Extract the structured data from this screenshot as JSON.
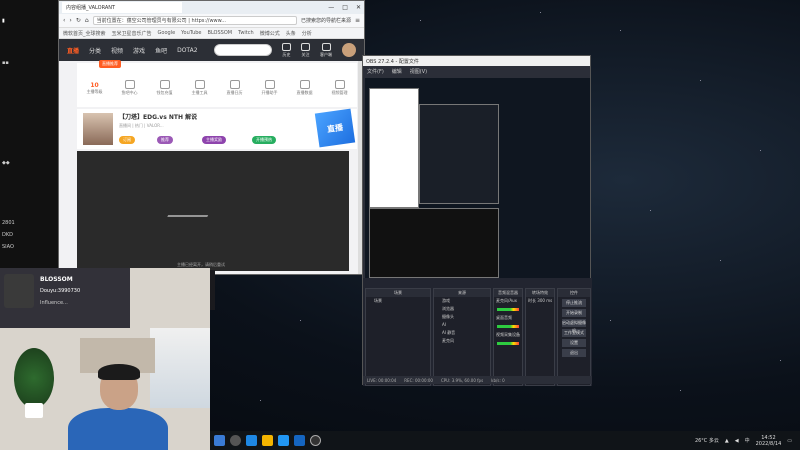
{
  "browser": {
    "tab_title": "内容组播_VALORANT",
    "address": "当前位置在：蕴空公司管理员与有限公司 | https://www...",
    "page_title_right": "已搜索您的导航栏来源",
    "bookmarks": [
      "微软首页_全球搜索",
      "玉米卫星音乐广告",
      "Google",
      "YouTube",
      "BLOSSOM",
      "Twitch",
      "微博公式",
      "头条",
      "分析"
    ],
    "nav_items": [
      "直播",
      "分类",
      "视频",
      "游戏",
      "鱼吧",
      "DOTA2"
    ],
    "header_icons": [
      "历史",
      "关注",
      "客户端"
    ]
  },
  "site_menu": {
    "live_badge": "直播推荐",
    "items": [
      {
        "num": "10",
        "label": "主播等级"
      },
      {
        "num": "",
        "label": "鱼吧中心"
      },
      {
        "num": "",
        "label": "钱包充值"
      },
      {
        "num": "",
        "label": "主播工具"
      },
      {
        "num": "",
        "label": "直播日历"
      },
      {
        "num": "",
        "label": "开播助手"
      },
      {
        "num": "",
        "label": "直播数据"
      },
      {
        "num": "",
        "label": "视频管理"
      }
    ]
  },
  "room": {
    "title": "【刀塔】EDG.vs NTH 解说",
    "subtitle": "直播间 | 热门 | VALOR...",
    "tags": [
      "订阅",
      "推荐",
      "主播奖励",
      "开播预热"
    ],
    "promo": "直播"
  },
  "video": {
    "caption": "主播已经离开，请稍后重试"
  },
  "obs": {
    "title": "OBS 27.2.4 - 配置文件",
    "menu": [
      "文件(F)",
      "编辑",
      "视图(V)"
    ],
    "dock_scenes": "场景",
    "dock_sources": "来源",
    "dock_mixer": "音频混音器",
    "dock_transitions": "转场特效",
    "dock_controls": "控件",
    "scene_name": "场景",
    "sources": [
      "游戏",
      "浏览器",
      "摄像头",
      "AI",
      "AI 静音",
      "麦克风"
    ],
    "mixer_channels": [
      "麦克风/Aux",
      "桌面音频",
      "视频采集设备"
    ],
    "transition_label": "时长",
    "transition_value": "300 ms",
    "controls": [
      "停止推流",
      "开始录制",
      "启动虚拟摄像机",
      "工作室模式",
      "设置",
      "退出"
    ],
    "status": [
      "LIVE: 00:00:04",
      "REC: 00:00:00",
      "CPU: 3.9%, 60.00 fps",
      "kb/s: 0"
    ]
  },
  "webcam": {
    "name": "BLOSSOM",
    "sub": "Douyu:3990730",
    "tagline": "Influence..."
  },
  "taskbar": {
    "weather": "26°C 多云",
    "time": "14:52",
    "date": "2022/8/14",
    "lang": "中"
  },
  "colors": {
    "brand": "#ff5d23",
    "obs_bg": "#2b2e38",
    "taskbar": "#101418"
  }
}
